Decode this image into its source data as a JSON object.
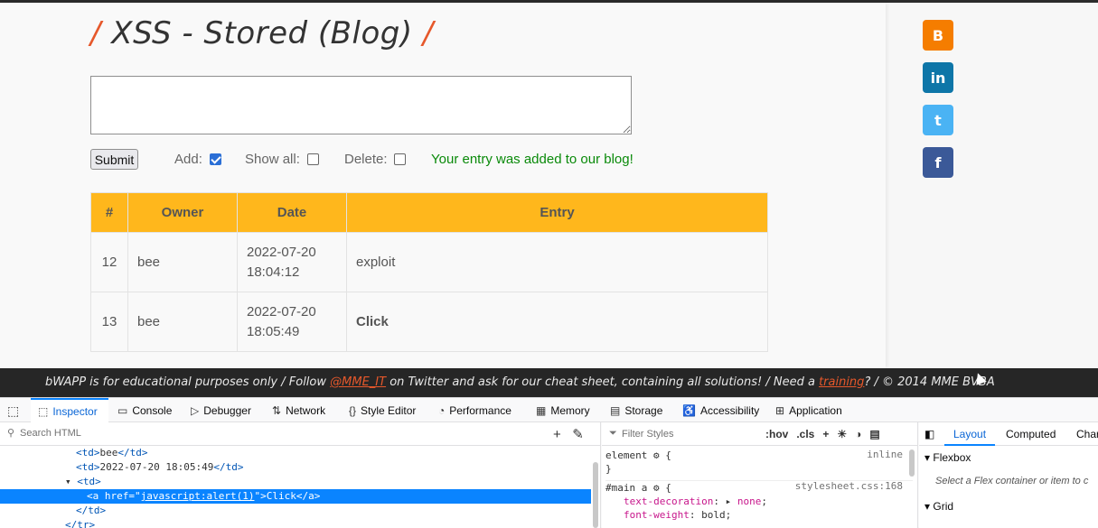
{
  "page": {
    "title_text": "XSS - Stored (Blog)",
    "slash": "/",
    "submit_label": "Submit",
    "add_label": "Add:",
    "add_checked": true,
    "show_all_label": "Show all:",
    "show_all_checked": false,
    "delete_label": "Delete:",
    "delete_checked": false,
    "message": "Your entry was added to our blog!",
    "table": {
      "headers": [
        "#",
        "Owner",
        "Date",
        "Entry"
      ],
      "rows": [
        {
          "num": "12",
          "owner": "bee",
          "date": "2022-07-20",
          "time": "18:04:12",
          "entry": "exploit"
        },
        {
          "num": "13",
          "owner": "bee",
          "date": "2022-07-20",
          "time": "18:05:49",
          "entry": "Click"
        }
      ]
    },
    "social": [
      {
        "name": "blogger-icon",
        "glyph": "B",
        "color": "#f57d00"
      },
      {
        "name": "linkedin-icon",
        "glyph": "in",
        "color": "#0e76a8"
      },
      {
        "name": "twitter-icon",
        "glyph": "t",
        "color": "#4ab3f4"
      },
      {
        "name": "facebook-icon",
        "glyph": "f",
        "color": "#3b5998"
      }
    ]
  },
  "footer": {
    "text1": "bWAPP is for educational purposes only / Follow ",
    "link1": "@MME_IT",
    "text2": " on Twitter and ask for our cheat sheet, containing all solutions! / Need a ",
    "link2": "training",
    "text3": "? / © 2014 MME BVBA"
  },
  "devtools": {
    "tabs": [
      "Inspector",
      "Console",
      "Debugger",
      "Network",
      "Style Editor",
      "Performance",
      "Memory",
      "Storage",
      "Accessibility",
      "Application"
    ],
    "search_placeholder": "Search HTML",
    "markup": {
      "line1": "bee",
      "line2": "2022-07-20 18:05:49",
      "line4_href": "javascript:alert(1)",
      "line4_text": "Click"
    },
    "rules": {
      "filter_placeholder": "Filter Styles",
      "hov": ":hov",
      "cls": ".cls",
      "element_selector": "element",
      "inline": "inline",
      "main_selector": "#main a",
      "source": "stylesheet.css:168",
      "prop1": "text-decoration",
      "val1": "none",
      "prop2": "font-weight",
      "val2": "bold"
    },
    "layout": {
      "tabs": [
        "Layout",
        "Computed",
        "Char"
      ],
      "flexbox": "Flexbox",
      "flex_note": "Select a Flex container or item to c",
      "grid": "Grid"
    }
  }
}
